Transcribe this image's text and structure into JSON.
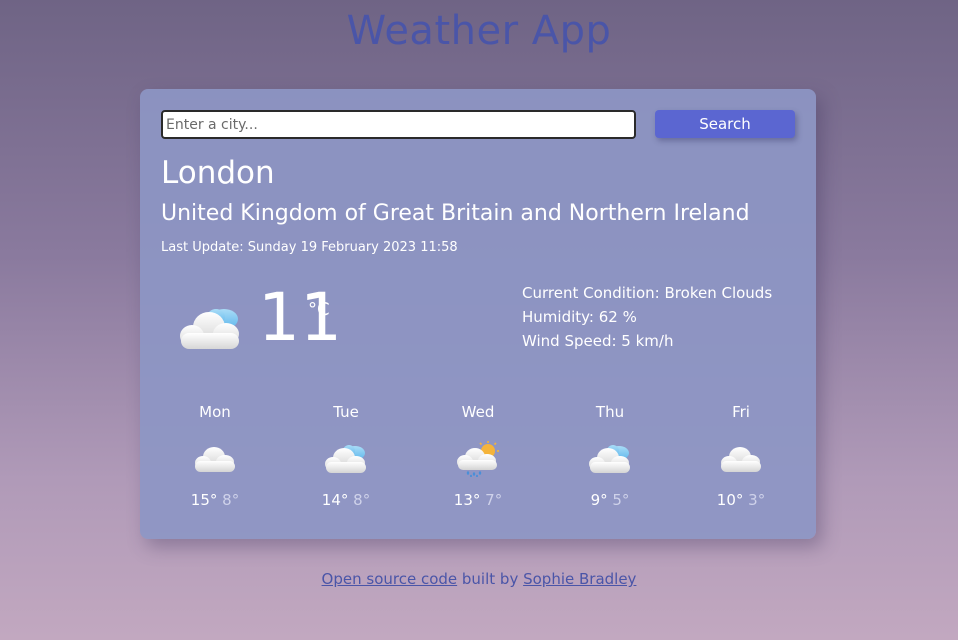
{
  "app": {
    "title": "Weather App"
  },
  "search": {
    "placeholder": "Enter a city...",
    "button_label": "Search"
  },
  "location": {
    "city": "London",
    "country": "United Kingdom of Great Britain and Northern Ireland",
    "last_update": "Last Update: Sunday 19 February 2023 11:58"
  },
  "current": {
    "icon": "cloud-sun-icon",
    "temp": "11",
    "unit": "°C",
    "condition": "Current Condition: Broken Clouds",
    "humidity": "Humidity: 62 %",
    "wind": "Wind Speed: 5 km/h"
  },
  "forecast": [
    {
      "day": "Mon",
      "icon": "cloud-icon",
      "high": "15°",
      "low": "8°"
    },
    {
      "day": "Tue",
      "icon": "cloud-sun-icon",
      "high": "14°",
      "low": "8°"
    },
    {
      "day": "Wed",
      "icon": "rain-sun-icon",
      "high": "13°",
      "low": "7°"
    },
    {
      "day": "Thu",
      "icon": "cloud-sun-icon",
      "high": "9°",
      "low": "5°"
    },
    {
      "day": "Fri",
      "icon": "cloud-icon",
      "high": "10°",
      "low": "3°"
    }
  ],
  "footer": {
    "source_link": "Open source code",
    "middle_text": " built by ",
    "author_link": "Sophie Bradley"
  },
  "colors": {
    "accent": "#5b66d1",
    "title": "#4a55a8"
  }
}
